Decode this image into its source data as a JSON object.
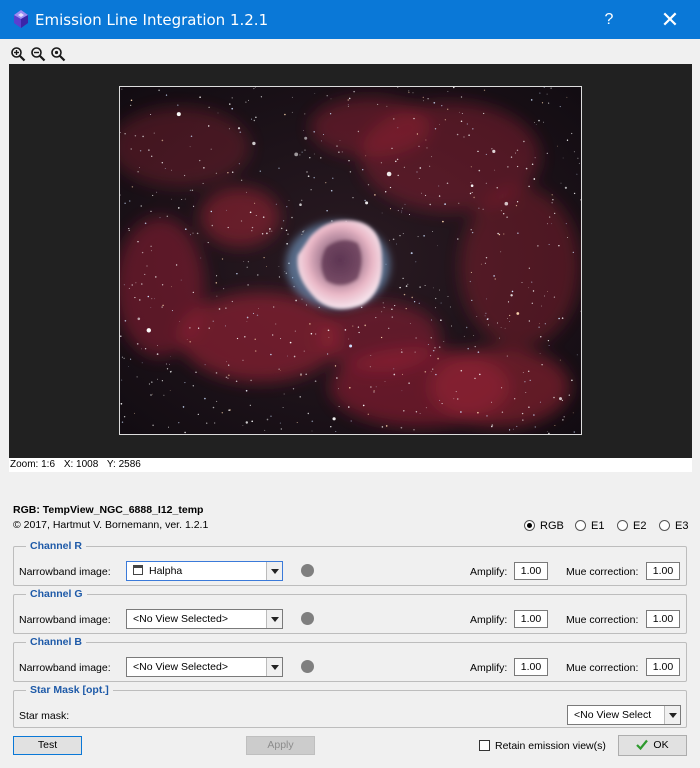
{
  "window": {
    "title": "Emission Line Integration 1.2.1",
    "help_glyph": "?",
    "close_glyph": "✕"
  },
  "toolbar": {
    "icons": [
      "zoom-in-icon",
      "zoom-out-icon",
      "zoom-fit-icon"
    ]
  },
  "readout": {
    "zoom": "Zoom: 1:6",
    "x": "X: 1008",
    "y": "Y: 2586"
  },
  "info": {
    "view_id": "RGB: TempView_NGC_6888_I12_temp",
    "copyright": "© 2017, Hartmut V. Bornemann, ver. 1.2.1"
  },
  "target_options": [
    {
      "label": "RGB",
      "checked": true
    },
    {
      "label": "E1",
      "checked": false
    },
    {
      "label": "E2",
      "checked": false
    },
    {
      "label": "E3",
      "checked": false
    }
  ],
  "channels": [
    {
      "title": "Channel R",
      "narrowband_label": "Narrowband image:",
      "selected": "Halpha",
      "amplify_label": "Amplify:",
      "amplify": "1.00",
      "mue_label": "Mue correction:",
      "mue": "1.00"
    },
    {
      "title": "Channel G",
      "narrowband_label": "Narrowband image:",
      "selected": "<No View Selected>",
      "amplify_label": "Amplify:",
      "amplify": "1.00",
      "mue_label": "Mue correction:",
      "mue": "1.00"
    },
    {
      "title": "Channel B",
      "narrowband_label": "Narrowband image:",
      "selected": "<No View Selected>",
      "amplify_label": "Amplify:",
      "amplify": "1.00",
      "mue_label": "Mue correction:",
      "mue": "1.00"
    }
  ],
  "star_mask": {
    "title": "Star Mask [opt.]",
    "label": "Star mask:",
    "selected": "<No View Select"
  },
  "buttons": {
    "test": "Test",
    "apply": "Apply",
    "retain_label": "Retain emission view(s)",
    "ok": "OK"
  },
  "colors": {
    "titlebar": "#0a78d7",
    "group_title": "#1e5aa8",
    "viewport_bg": "#212121",
    "indicator": "#7f7f7f",
    "ok_check": "#2e9a2e"
  }
}
